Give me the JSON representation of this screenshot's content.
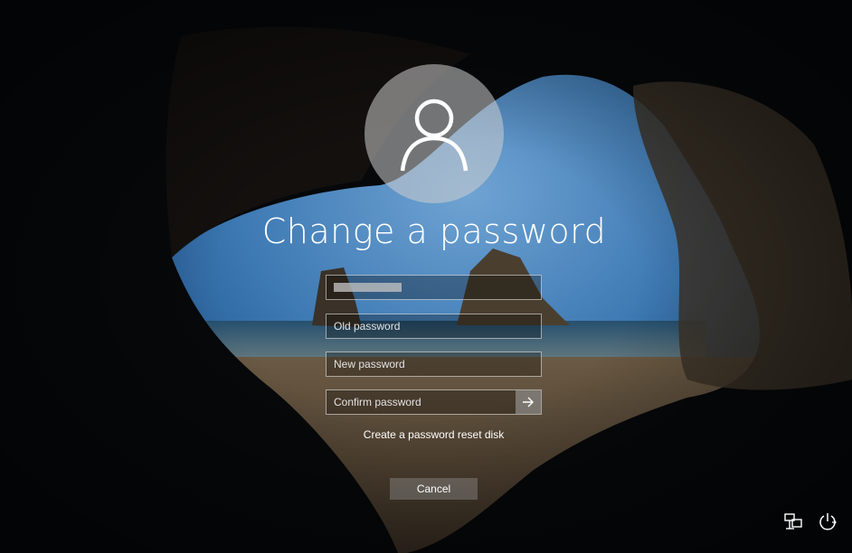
{
  "screen": {
    "title": "Change a password"
  },
  "form": {
    "username_value": "",
    "old_password_placeholder": "Old password",
    "new_password_placeholder": "New password",
    "confirm_password_placeholder": "Confirm password",
    "submit_icon": "arrow-right-icon"
  },
  "links": {
    "reset_disk": "Create a password reset disk"
  },
  "buttons": {
    "cancel": "Cancel"
  },
  "tray": {
    "network_icon": "network-icon",
    "power_icon": "power-icon"
  }
}
